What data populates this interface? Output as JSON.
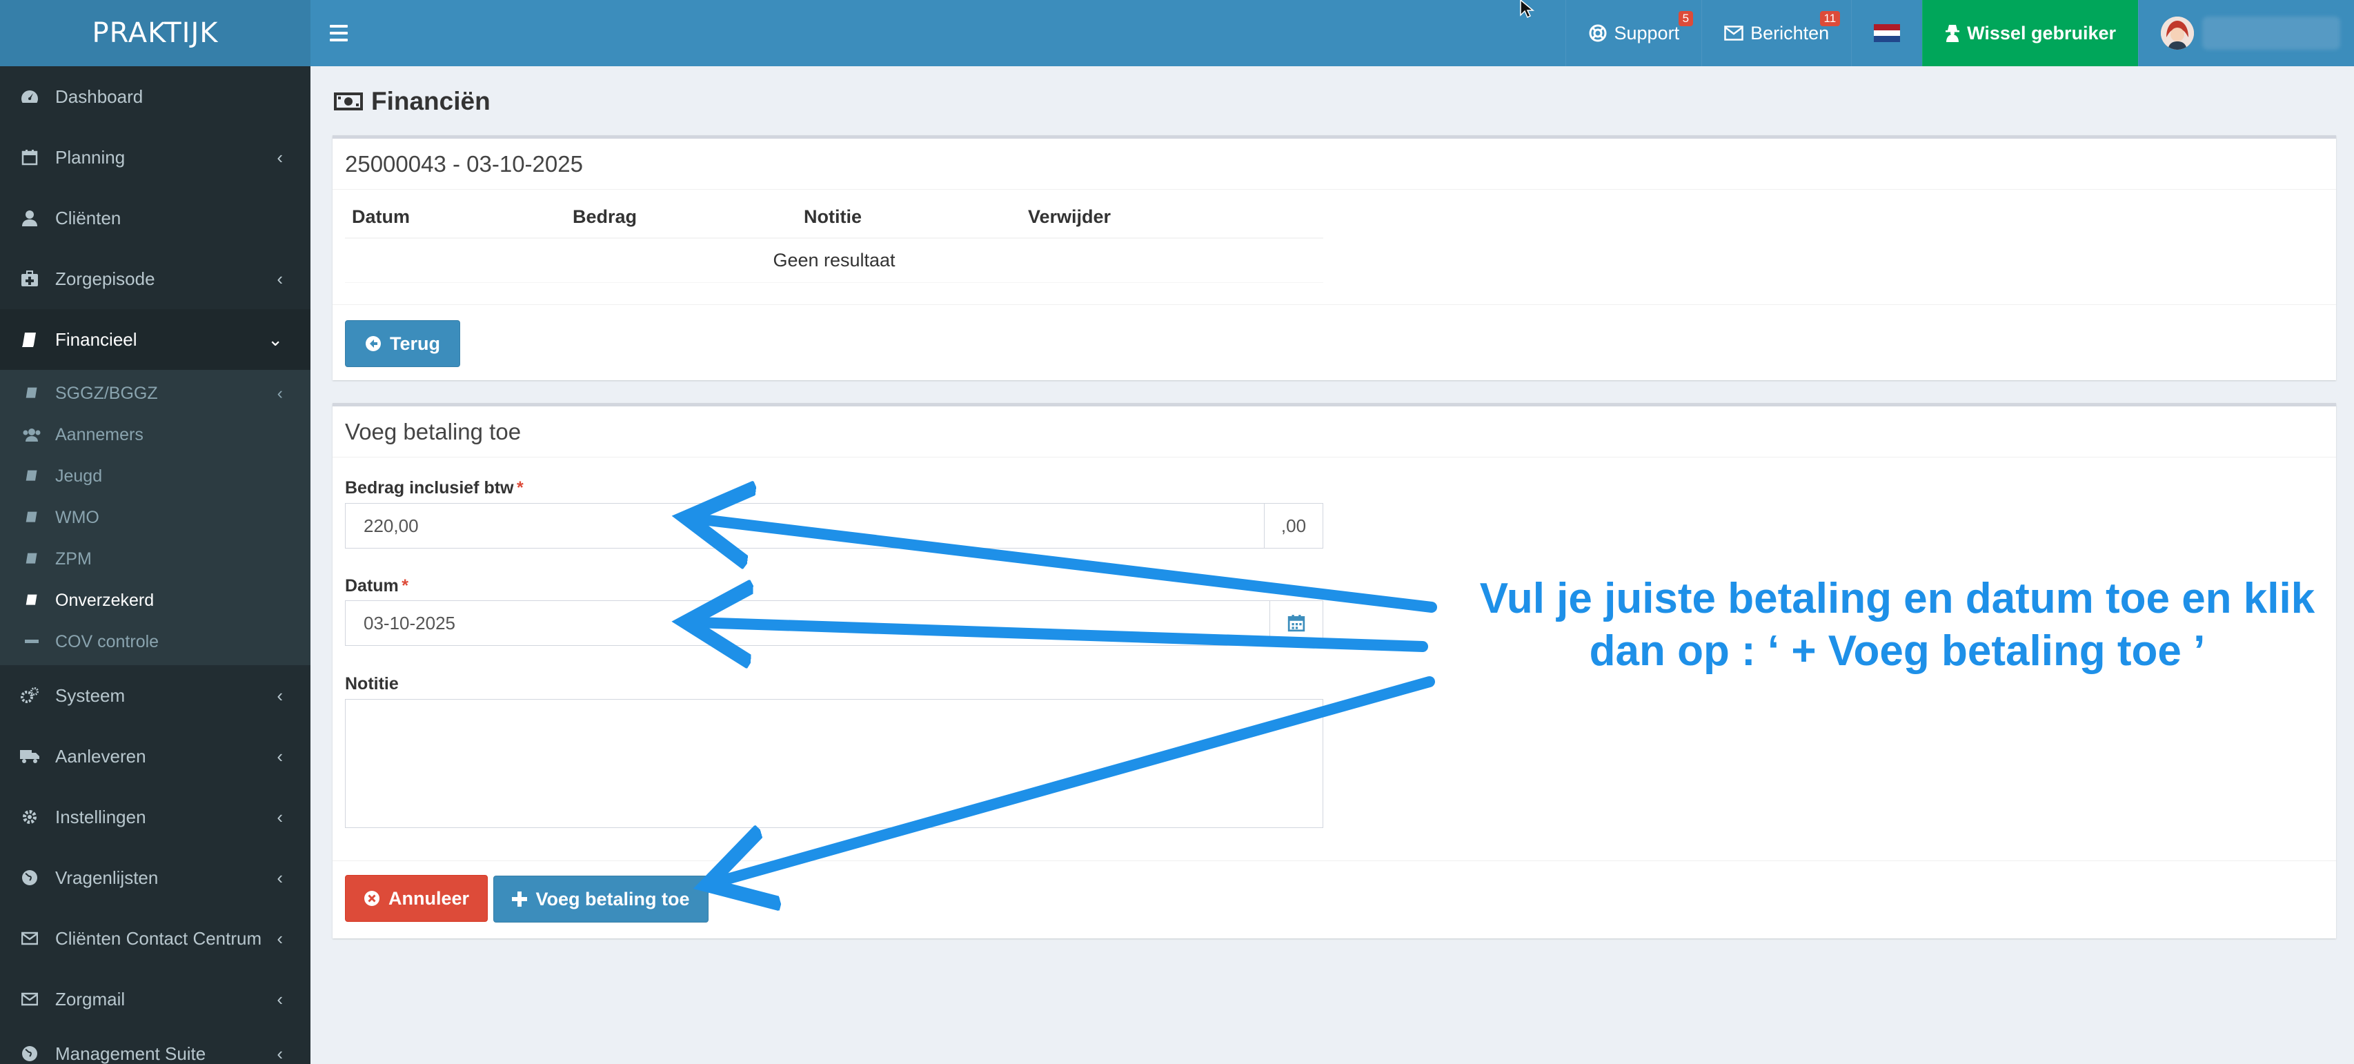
{
  "brand": "PRAKTIJK",
  "header": {
    "support_label": "Support",
    "support_badge": "5",
    "messages_label": "Berichten",
    "messages_badge": "11",
    "switch_user_label": "Wissel gebruiker"
  },
  "sidebar": {
    "items": [
      {
        "label": "Dashboard"
      },
      {
        "label": "Planning"
      },
      {
        "label": "Cliënten"
      },
      {
        "label": "Zorgepisode"
      },
      {
        "label": "Financieel"
      },
      {
        "label": "Systeem"
      },
      {
        "label": "Aanleveren"
      },
      {
        "label": "Instellingen"
      },
      {
        "label": "Vragenlijsten"
      },
      {
        "label": "Cliënten Contact Centrum"
      },
      {
        "label": "Zorgmail"
      },
      {
        "label": "Management Suite"
      }
    ],
    "submenu": [
      {
        "label": "SGGZ/BGGZ"
      },
      {
        "label": "Aannemers"
      },
      {
        "label": "Jeugd"
      },
      {
        "label": "WMO"
      },
      {
        "label": "ZPM"
      },
      {
        "label": "Onverzekerd"
      },
      {
        "label": "COV controle"
      }
    ]
  },
  "page": {
    "title": "Financiën"
  },
  "invoice_box": {
    "title": "25000043 - 03-10-2025",
    "columns": [
      "Datum",
      "Bedrag",
      "Notitie",
      "Verwijder"
    ],
    "empty_text": "Geen resultaat",
    "back_button": "Terug"
  },
  "payment_form": {
    "title": "Voeg betaling toe",
    "amount_label": "Bedrag inclusief btw",
    "amount_value": "220,00",
    "amount_suffix": ",00",
    "date_label": "Datum",
    "date_value": "03-10-2025",
    "note_label": "Notitie",
    "note_value": "",
    "required_marker": "*",
    "cancel_button": "Annuleer",
    "submit_button": "Voeg betaling toe"
  },
  "annotation": {
    "line1": "Vul je juiste betaling en datum toe en klik",
    "line2": "dan op : ‘ + Voeg betaling toe ’",
    "color": "#1e90e8"
  },
  "colors": {
    "header": "#3c8dbc",
    "logo": "#367fa9",
    "sidebar": "#222d32",
    "switch_user": "#00a65a",
    "danger": "#dd4b39"
  }
}
